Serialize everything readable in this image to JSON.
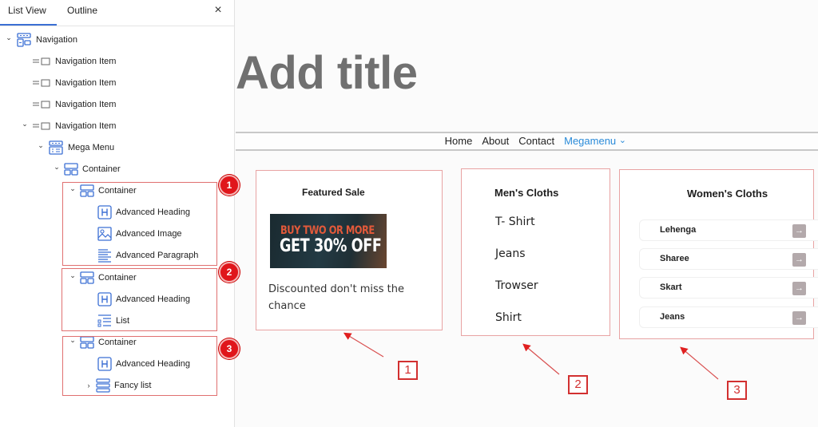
{
  "sidebar": {
    "tabs": [
      "List View",
      "Outline"
    ],
    "close_icon": "×",
    "tree": [
      {
        "label": "Navigation",
        "icon": "navigation-block-icon",
        "expanded": true
      },
      {
        "label": "Navigation Item",
        "icon": "navigation-item-icon"
      },
      {
        "label": "Navigation Item",
        "icon": "navigation-item-icon"
      },
      {
        "label": "Navigation Item",
        "icon": "navigation-item-icon"
      },
      {
        "label": "Navigation Item",
        "icon": "navigation-item-icon",
        "expanded": true
      },
      {
        "label": "Mega Menu",
        "icon": "mega-menu-icon",
        "expanded": true
      },
      {
        "label": "Container",
        "icon": "container-icon",
        "expanded": true
      },
      {
        "label": "Container",
        "icon": "container-icon",
        "expanded": true
      },
      {
        "label": "Advanced Heading",
        "icon": "heading-icon"
      },
      {
        "label": "Advanced Image",
        "icon": "image-icon"
      },
      {
        "label": "Advanced Paragraph",
        "icon": "paragraph-icon"
      },
      {
        "label": "Container",
        "icon": "container-icon",
        "expanded": true
      },
      {
        "label": "Advanced Heading",
        "icon": "heading-icon"
      },
      {
        "label": "List",
        "icon": "list-icon"
      },
      {
        "label": "Container",
        "icon": "container-icon",
        "expanded": true
      },
      {
        "label": "Advanced Heading",
        "icon": "heading-icon"
      },
      {
        "label": "Fancy list",
        "icon": "fancy-list-icon",
        "expanded": false
      }
    ],
    "badges": [
      "1",
      "2",
      "3"
    ]
  },
  "canvas": {
    "title": "Add title",
    "nav": {
      "links": [
        "Home",
        "About",
        "Contact",
        "Megamenu"
      ],
      "active": "Megamenu",
      "dropdown_icon": "⌄"
    },
    "featured": {
      "heading": "Featured Sale",
      "promo_line1": "BUY TWO OR MORE",
      "promo_line2": "GET 30% OFF",
      "paragraph": "Discounted don't miss the chance"
    },
    "mens": {
      "heading": "Men's Cloths",
      "items": [
        "T- Shirt",
        "Jeans",
        "Trowser",
        "Shirt"
      ]
    },
    "womens": {
      "heading": "Women's Cloths",
      "items": [
        "Lehenga",
        "Sharee",
        "Skart",
        "Jeans"
      ],
      "arrow_icon": "→"
    },
    "callouts": [
      "1",
      "2",
      "3"
    ]
  },
  "colors": {
    "accent": "#2a8bd9",
    "annotation": "#e0161b",
    "icon_blue": "#3b6fd4"
  }
}
